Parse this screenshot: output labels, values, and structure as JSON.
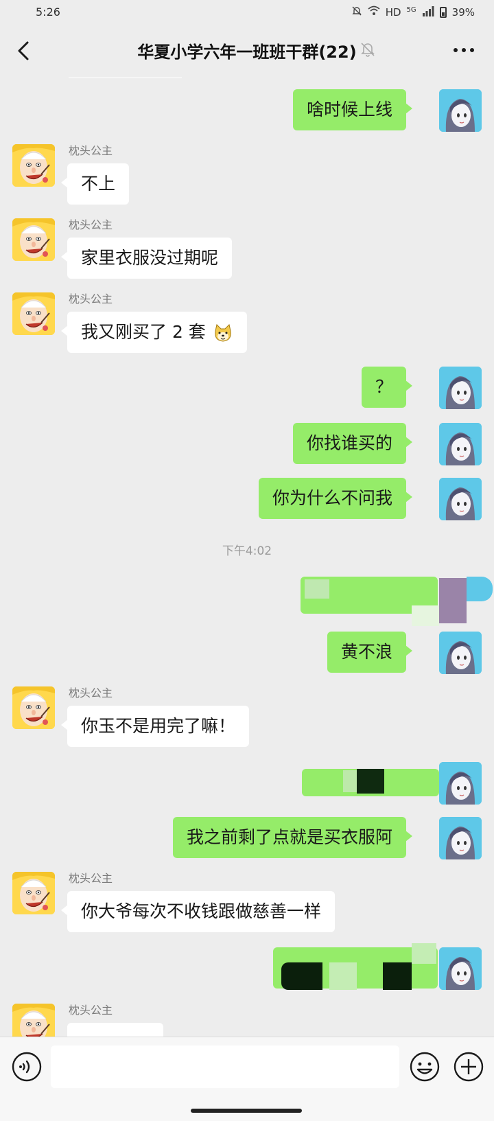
{
  "status_bar": {
    "time": "5:26",
    "network": "HD",
    "net_gen": "5G",
    "battery": "39%"
  },
  "header": {
    "title": "华夏小学六年一班班干群(22)"
  },
  "messages": [
    {
      "dir": "out",
      "text": "啥时候上线"
    },
    {
      "dir": "in",
      "sender": "枕头公主",
      "text": "不上"
    },
    {
      "dir": "in",
      "sender": "枕头公主",
      "text": "家里衣服没过期呢"
    },
    {
      "dir": "in",
      "sender": "枕头公主",
      "text": "我又刚买了 2 套",
      "emoji": "doge-emoji"
    },
    {
      "dir": "out",
      "text": "？"
    },
    {
      "dir": "out",
      "text": "你找谁买的"
    },
    {
      "dir": "out",
      "text": "你为什么不问我"
    },
    {
      "type": "time",
      "text": "下午4:02"
    },
    {
      "dir": "out",
      "redacted": true
    },
    {
      "dir": "out",
      "text": "黄不浪"
    },
    {
      "dir": "in",
      "sender": "枕头公主",
      "text": "你玉不是用完了嘛！"
    },
    {
      "dir": "out",
      "redacted": true
    },
    {
      "dir": "out",
      "text": "我之前剩了点就是买衣服阿"
    },
    {
      "dir": "in",
      "sender": "枕头公主",
      "text": "你大爷每次不收钱跟做慈善一样"
    },
    {
      "dir": "out",
      "redacted": true
    },
    {
      "dir": "in",
      "sender": "枕头公主",
      "text": ""
    }
  ],
  "input": {
    "placeholder": "",
    "value": ""
  },
  "icons": {
    "back": "back-arrow-icon",
    "mute": "bell-off-icon",
    "more": "more-dots-icon",
    "voice": "voice-icon",
    "emoji": "emoji-icon",
    "plus": "plus-icon"
  },
  "colors": {
    "background": "#ededed",
    "outgoing_bubble": "#95ec69",
    "incoming_bubble": "#ffffff",
    "self_avatar": "#5ec8e8",
    "other_avatar": "#ffd84d"
  }
}
